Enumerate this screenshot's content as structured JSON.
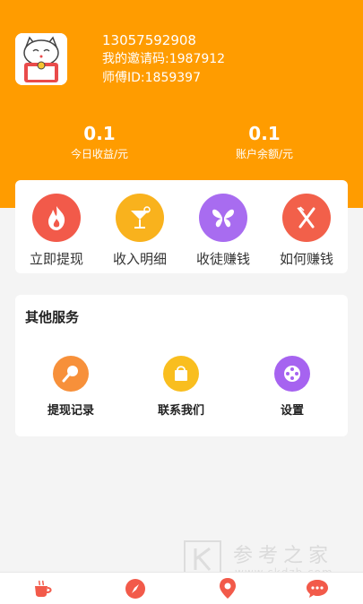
{
  "user": {
    "phone": "13057592908",
    "invite_label": "我的邀请码:",
    "invite_code": "1987912",
    "master_label": "师傅ID:",
    "master_id": "1859397"
  },
  "stats": [
    {
      "value": "0.1",
      "label": "今日收益/元"
    },
    {
      "value": "0.1",
      "label": "账户余额/元"
    }
  ],
  "actions": [
    {
      "label": "立即提现",
      "icon": "flame-icon",
      "color": "#f25a4a"
    },
    {
      "label": "收入明细",
      "icon": "cocktail-icon",
      "color": "#f9b21d"
    },
    {
      "label": "收徒赚钱",
      "icon": "butterfly-icon",
      "color": "#a86cf0"
    },
    {
      "label": "如何赚钱",
      "icon": "fork-knife-icon",
      "color": "#f2604a"
    }
  ],
  "services": {
    "title": "其他服务",
    "items": [
      {
        "label": "提现记录",
        "icon": "microphone-icon",
        "color": "#f7903a"
      },
      {
        "label": "联系我们",
        "icon": "shopping-bag-icon",
        "color": "#f9be1f"
      },
      {
        "label": "设置",
        "icon": "film-reel-icon",
        "color": "#a663f0"
      }
    ]
  },
  "watermark": {
    "main": "参考之家",
    "sub": "www.ckdzb.com"
  },
  "tabs": [
    {
      "icon": "coffee-cup-icon"
    },
    {
      "icon": "compass-icon"
    },
    {
      "icon": "location-pin-icon"
    },
    {
      "icon": "chat-bubble-icon"
    }
  ]
}
